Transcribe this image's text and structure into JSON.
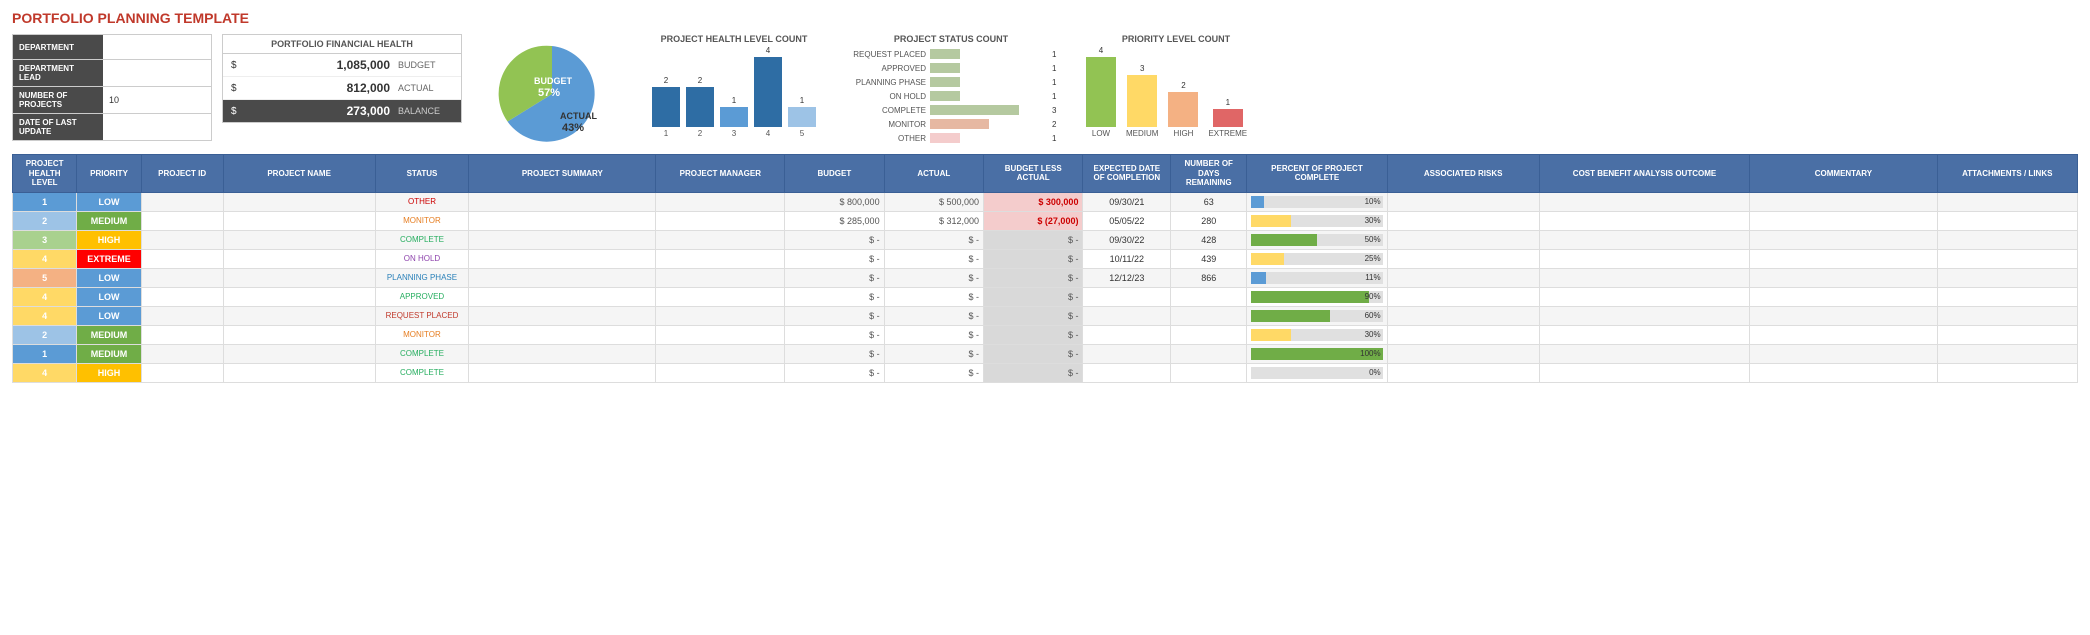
{
  "page": {
    "title": "PORTFOLIO PLANNING TEMPLATE"
  },
  "info": {
    "department_label": "DEPARTMENT",
    "department_value": "",
    "lead_label": "DEPARTMENT LEAD",
    "lead_value": "",
    "projects_label": "NUMBER OF PROJECTS",
    "projects_value": "10",
    "update_label": "DATE OF LAST UPDATE",
    "update_value": ""
  },
  "financial": {
    "title": "PORTFOLIO FINANCIAL HEALTH",
    "budget_dollar": "$",
    "budget_amount": "1,085,000",
    "budget_label": "BUDGET",
    "actual_dollar": "$",
    "actual_amount": "812,000",
    "actual_label": "ACTUAL",
    "balance_dollar": "$",
    "balance_amount": "273,000",
    "balance_label": "BALANCE"
  },
  "pie": {
    "budget_label": "BUDGET",
    "budget_pct": "57%",
    "actual_label": "ACTUAL",
    "actual_pct": "43%",
    "budget_color": "#5b9bd5",
    "actual_color": "#92c353"
  },
  "project_health_chart": {
    "title": "PROJECT HEALTH LEVEL COUNT",
    "bars": [
      {
        "label": "1",
        "value": 2,
        "color": "#2e6da4"
      },
      {
        "label": "2",
        "value": 2,
        "color": "#2e6da4"
      },
      {
        "label": "3",
        "value": 1,
        "color": "#2e6da4"
      },
      {
        "label": "4",
        "value": 4,
        "color": "#2e6da4"
      },
      {
        "label": "5",
        "value": 1,
        "color": "#2e6da4"
      }
    ]
  },
  "project_status_chart": {
    "title": "PROJECT STATUS COUNT",
    "items": [
      {
        "label": "REQUEST PLACED",
        "value": 1,
        "color": "#b5c9a0"
      },
      {
        "label": "APPROVED",
        "value": 1,
        "color": "#b5c9a0"
      },
      {
        "label": "PLANNING PHASE",
        "value": 1,
        "color": "#b5c9a0"
      },
      {
        "label": "ON HOLD",
        "value": 1,
        "color": "#b5c9a0"
      },
      {
        "label": "COMPLETE",
        "value": 3,
        "color": "#b5c9a0"
      },
      {
        "label": "MONITOR",
        "value": 2,
        "color": "#e6b8a2"
      },
      {
        "label": "OTHER",
        "value": 1,
        "color": "#f4cccc"
      }
    ],
    "max_value": 4
  },
  "priority_chart": {
    "title": "PRIORITY LEVEL COUNT",
    "bars": [
      {
        "label": "LOW",
        "value": 4,
        "color": "#92c353"
      },
      {
        "label": "MEDIUM",
        "value": 3,
        "color": "#ffd966"
      },
      {
        "label": "HIGH",
        "value": 2,
        "color": "#f4b183"
      },
      {
        "label": "EXTREME",
        "value": 1,
        "color": "#f4b183"
      }
    ]
  },
  "table": {
    "headers": [
      "PROJECT HEALTH LEVEL",
      "PRIORITY",
      "PROJECT ID",
      "PROJECT NAME",
      "STATUS",
      "PROJECT SUMMARY",
      "PROJECT MANAGER",
      "BUDGET",
      "ACTUAL",
      "BUDGET LESS ACTUAL",
      "EXPECTED DATE OF COMPLETION",
      "NUMBER OF DAYS REMAINING",
      "PERCENT OF PROJECT COMPLETE",
      "ASSOCIATED RISKS",
      "COST BENEFIT ANALYSIS OUTCOME",
      "COMMENTARY",
      "ATTACHMENTS / LINKS"
    ],
    "rows": [
      {
        "health": "1",
        "health_class": "health-1",
        "priority": "LOW",
        "priority_class": "priority-low",
        "project_id": "",
        "project_name": "",
        "status": "OTHER",
        "status_class": "status-other",
        "summary": "",
        "manager": "",
        "budget": "$ 800,000",
        "actual": "$ 500,000",
        "balance": "$ 300,000",
        "balance_class": "budget-negative",
        "expected": "09/30/21",
        "days": "63",
        "progress": 10,
        "risks": "",
        "cost": "",
        "commentary": "",
        "attachments": ""
      },
      {
        "health": "2",
        "health_class": "health-2",
        "priority": "MEDIUM",
        "priority_class": "priority-medium",
        "project_id": "",
        "project_name": "",
        "status": "MONITOR",
        "status_class": "status-monitor",
        "summary": "",
        "manager": "",
        "budget": "$ 285,000",
        "actual": "$ 312,000",
        "balance": "$ (27,000)",
        "balance_class": "budget-negative",
        "expected": "05/05/22",
        "days": "280",
        "progress": 30,
        "risks": "",
        "cost": "",
        "commentary": "",
        "attachments": ""
      },
      {
        "health": "3",
        "health_class": "health-3",
        "priority": "HIGH",
        "priority_class": "priority-high",
        "project_id": "",
        "project_name": "",
        "status": "COMPLETE",
        "status_class": "status-complete",
        "summary": "",
        "manager": "",
        "budget": "$ -",
        "actual": "$ -",
        "balance": "$ -",
        "balance_class": "budget-neutral",
        "expected": "09/30/22",
        "days": "428",
        "progress": 50,
        "risks": "",
        "cost": "",
        "commentary": "",
        "attachments": ""
      },
      {
        "health": "4",
        "health_class": "health-4",
        "priority": "EXTREME",
        "priority_class": "priority-extreme",
        "project_id": "",
        "project_name": "",
        "status": "ON HOLD",
        "status_class": "status-onhold",
        "summary": "",
        "manager": "",
        "budget": "$ -",
        "actual": "$ -",
        "balance": "$ -",
        "balance_class": "budget-neutral",
        "expected": "10/11/22",
        "days": "439",
        "progress": 25,
        "risks": "",
        "cost": "",
        "commentary": "",
        "attachments": ""
      },
      {
        "health": "5",
        "health_class": "health-5",
        "priority": "LOW",
        "priority_class": "priority-low",
        "project_id": "",
        "project_name": "",
        "status": "PLANNING PHASE",
        "status_class": "status-planning",
        "summary": "",
        "manager": "",
        "budget": "$ -",
        "actual": "$ -",
        "balance": "$ -",
        "balance_class": "budget-neutral",
        "expected": "12/12/23",
        "days": "866",
        "progress": 11,
        "risks": "",
        "cost": "",
        "commentary": "",
        "attachments": ""
      },
      {
        "health": "4",
        "health_class": "health-4",
        "priority": "LOW",
        "priority_class": "priority-low",
        "project_id": "",
        "project_name": "",
        "status": "APPROVED",
        "status_class": "status-approved",
        "summary": "",
        "manager": "",
        "budget": "$ -",
        "actual": "$ -",
        "balance": "$ -",
        "balance_class": "budget-neutral",
        "expected": "",
        "days": "",
        "progress": 90,
        "risks": "",
        "cost": "",
        "commentary": "",
        "attachments": ""
      },
      {
        "health": "4",
        "health_class": "health-4",
        "priority": "LOW",
        "priority_class": "priority-low",
        "project_id": "",
        "project_name": "",
        "status": "REQUEST PLACED",
        "status_class": "status-request",
        "summary": "",
        "manager": "",
        "budget": "$ -",
        "actual": "$ -",
        "balance": "$ -",
        "balance_class": "budget-neutral",
        "expected": "",
        "days": "",
        "progress": 60,
        "risks": "",
        "cost": "",
        "commentary": "",
        "attachments": ""
      },
      {
        "health": "2",
        "health_class": "health-2",
        "priority": "MEDIUM",
        "priority_class": "priority-medium",
        "project_id": "",
        "project_name": "",
        "status": "MONITOR",
        "status_class": "status-monitor",
        "summary": "",
        "manager": "",
        "budget": "$ -",
        "actual": "$ -",
        "balance": "$ -",
        "balance_class": "budget-neutral",
        "expected": "",
        "days": "",
        "progress": 30,
        "risks": "",
        "cost": "",
        "commentary": "",
        "attachments": ""
      },
      {
        "health": "1",
        "health_class": "health-1",
        "priority": "MEDIUM",
        "priority_class": "priority-medium",
        "project_id": "",
        "project_name": "",
        "status": "COMPLETE",
        "status_class": "status-complete",
        "summary": "",
        "manager": "",
        "budget": "$ -",
        "actual": "$ -",
        "balance": "$ -",
        "balance_class": "budget-neutral",
        "expected": "",
        "days": "",
        "progress": 100,
        "risks": "",
        "cost": "",
        "commentary": "",
        "attachments": ""
      },
      {
        "health": "4",
        "health_class": "health-4",
        "priority": "HIGH",
        "priority_class": "priority-high",
        "project_id": "",
        "project_name": "",
        "status": "COMPLETE",
        "status_class": "status-complete",
        "summary": "",
        "manager": "",
        "budget": "$ -",
        "actual": "$ -",
        "balance": "$ -",
        "balance_class": "budget-neutral",
        "expected": "",
        "days": "",
        "progress": 0,
        "risks": "",
        "cost": "",
        "commentary": "",
        "attachments": ""
      }
    ]
  }
}
